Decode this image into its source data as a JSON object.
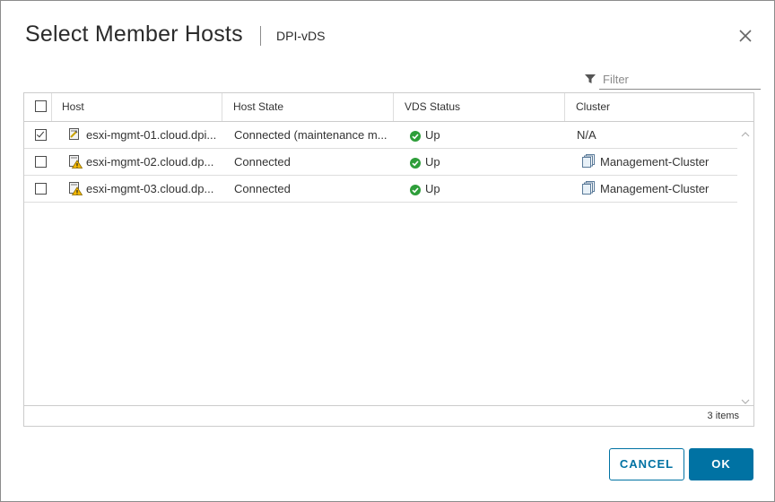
{
  "dialog": {
    "title": "Select Member Hosts",
    "subtitle": "DPI-vDS"
  },
  "filter": {
    "placeholder": "Filter",
    "value": ""
  },
  "table": {
    "columns": [
      "Host",
      "Host State",
      "VDS Status",
      "Cluster"
    ],
    "rows": [
      {
        "checked": true,
        "host": "esxi-mgmt-01.cloud.dpi...",
        "host_icon": "host-maintenance-icon",
        "host_state": "Connected (maintenance m...",
        "vds_status": "Up",
        "vds_status_icon": "check-circle-icon",
        "cluster": "N/A",
        "cluster_icon": ""
      },
      {
        "checked": false,
        "host": "esxi-mgmt-02.cloud.dp...",
        "host_icon": "host-warning-icon",
        "host_state": "Connected",
        "vds_status": "Up",
        "vds_status_icon": "check-circle-icon",
        "cluster": "Management-Cluster",
        "cluster_icon": "cluster-icon"
      },
      {
        "checked": false,
        "host": "esxi-mgmt-03.cloud.dp...",
        "host_icon": "host-warning-icon",
        "host_state": "Connected",
        "vds_status": "Up",
        "vds_status_icon": "check-circle-icon",
        "cluster": "Management-Cluster",
        "cluster_icon": "cluster-icon"
      }
    ],
    "footer": "3 items"
  },
  "buttons": {
    "cancel": "CANCEL",
    "ok": "OK"
  },
  "colors": {
    "primary": "#0072a3",
    "success": "#2e9e3a",
    "warning": "#f5b800"
  }
}
